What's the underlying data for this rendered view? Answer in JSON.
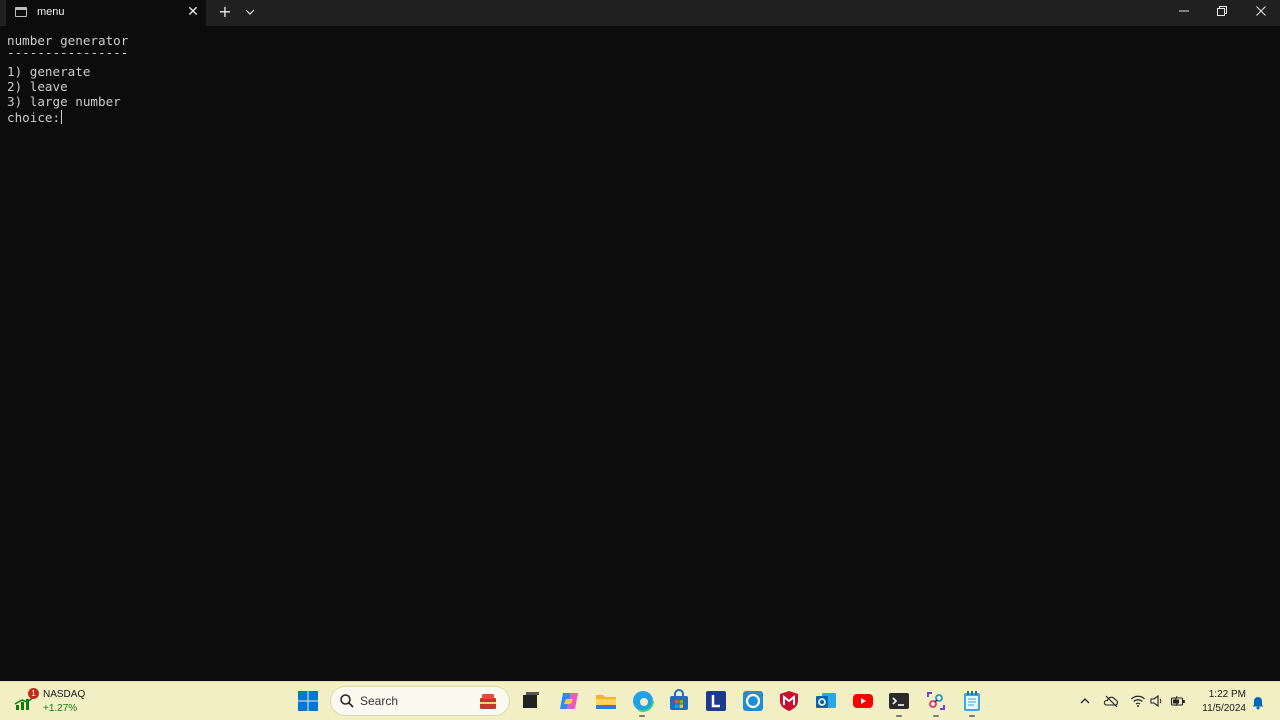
{
  "window": {
    "tab_title": "menu",
    "tab_close_symbol": "✕",
    "new_tab_symbol": "+",
    "minimize_symbol": "—",
    "maximize_symbol": "❐",
    "close_symbol": "✕"
  },
  "terminal": {
    "lines": [
      "number generator",
      "----------------",
      "1) generate",
      "2) leave",
      "3) large number",
      "choice:"
    ],
    "text_color": "#cccccc",
    "background": "#0c0c0c"
  },
  "taskbar": {
    "widget": {
      "badge": "1",
      "name": "NASDAQ",
      "change": "+1.27%"
    },
    "search": {
      "placeholder": "Search"
    },
    "apps": [
      "windows-start-icon",
      "task-view-icon",
      "copilot-icon",
      "file-explorer-icon",
      "edge-icon",
      "store-icon",
      "l-app-icon",
      "alexa-icon",
      "mcafee-icon",
      "outlook-icon",
      "youtube-icon",
      "terminal-icon",
      "snipping-tool-icon",
      "notepad-icon"
    ],
    "tray": {
      "icons": [
        "chevron-up-icon",
        "onedrive-icon",
        "wifi-icon",
        "volume-icon",
        "battery-icon",
        "notification-bell-icon"
      ],
      "time": "1:22 PM",
      "date": "11/5/2024"
    },
    "background": "#f2efc4"
  }
}
